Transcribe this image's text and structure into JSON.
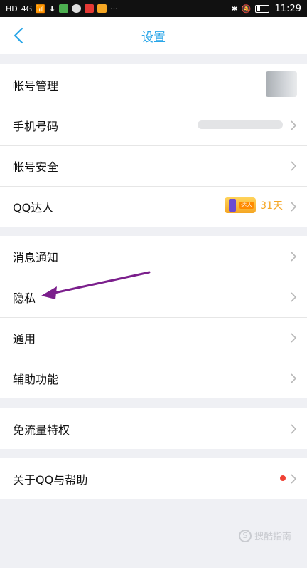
{
  "status_bar": {
    "hd_label": "HD",
    "signal_label": "4G",
    "time": "11:29"
  },
  "nav": {
    "back_icon": "chevron-left-icon",
    "title": "设置"
  },
  "groups": [
    {
      "items": [
        {
          "label": "帐号管理"
        },
        {
          "label": "手机号码"
        },
        {
          "label": "帐号安全"
        },
        {
          "label": "QQ达人",
          "badge_tag": "达人",
          "badge_days": "31天"
        }
      ]
    },
    {
      "items": [
        {
          "label": "消息通知"
        },
        {
          "label": "隐私"
        },
        {
          "label": "通用"
        },
        {
          "label": "辅助功能"
        }
      ]
    },
    {
      "items": [
        {
          "label": "免流量特权"
        }
      ]
    },
    {
      "items": [
        {
          "label": "关于QQ与帮助"
        }
      ]
    }
  ],
  "colors": {
    "accent": "#2aa6e8",
    "annotation_arrow": "#7b1f8c",
    "red_dot": "#f04134"
  },
  "watermark": {
    "icon": "s-circle-icon",
    "text": "搜酷指南"
  }
}
